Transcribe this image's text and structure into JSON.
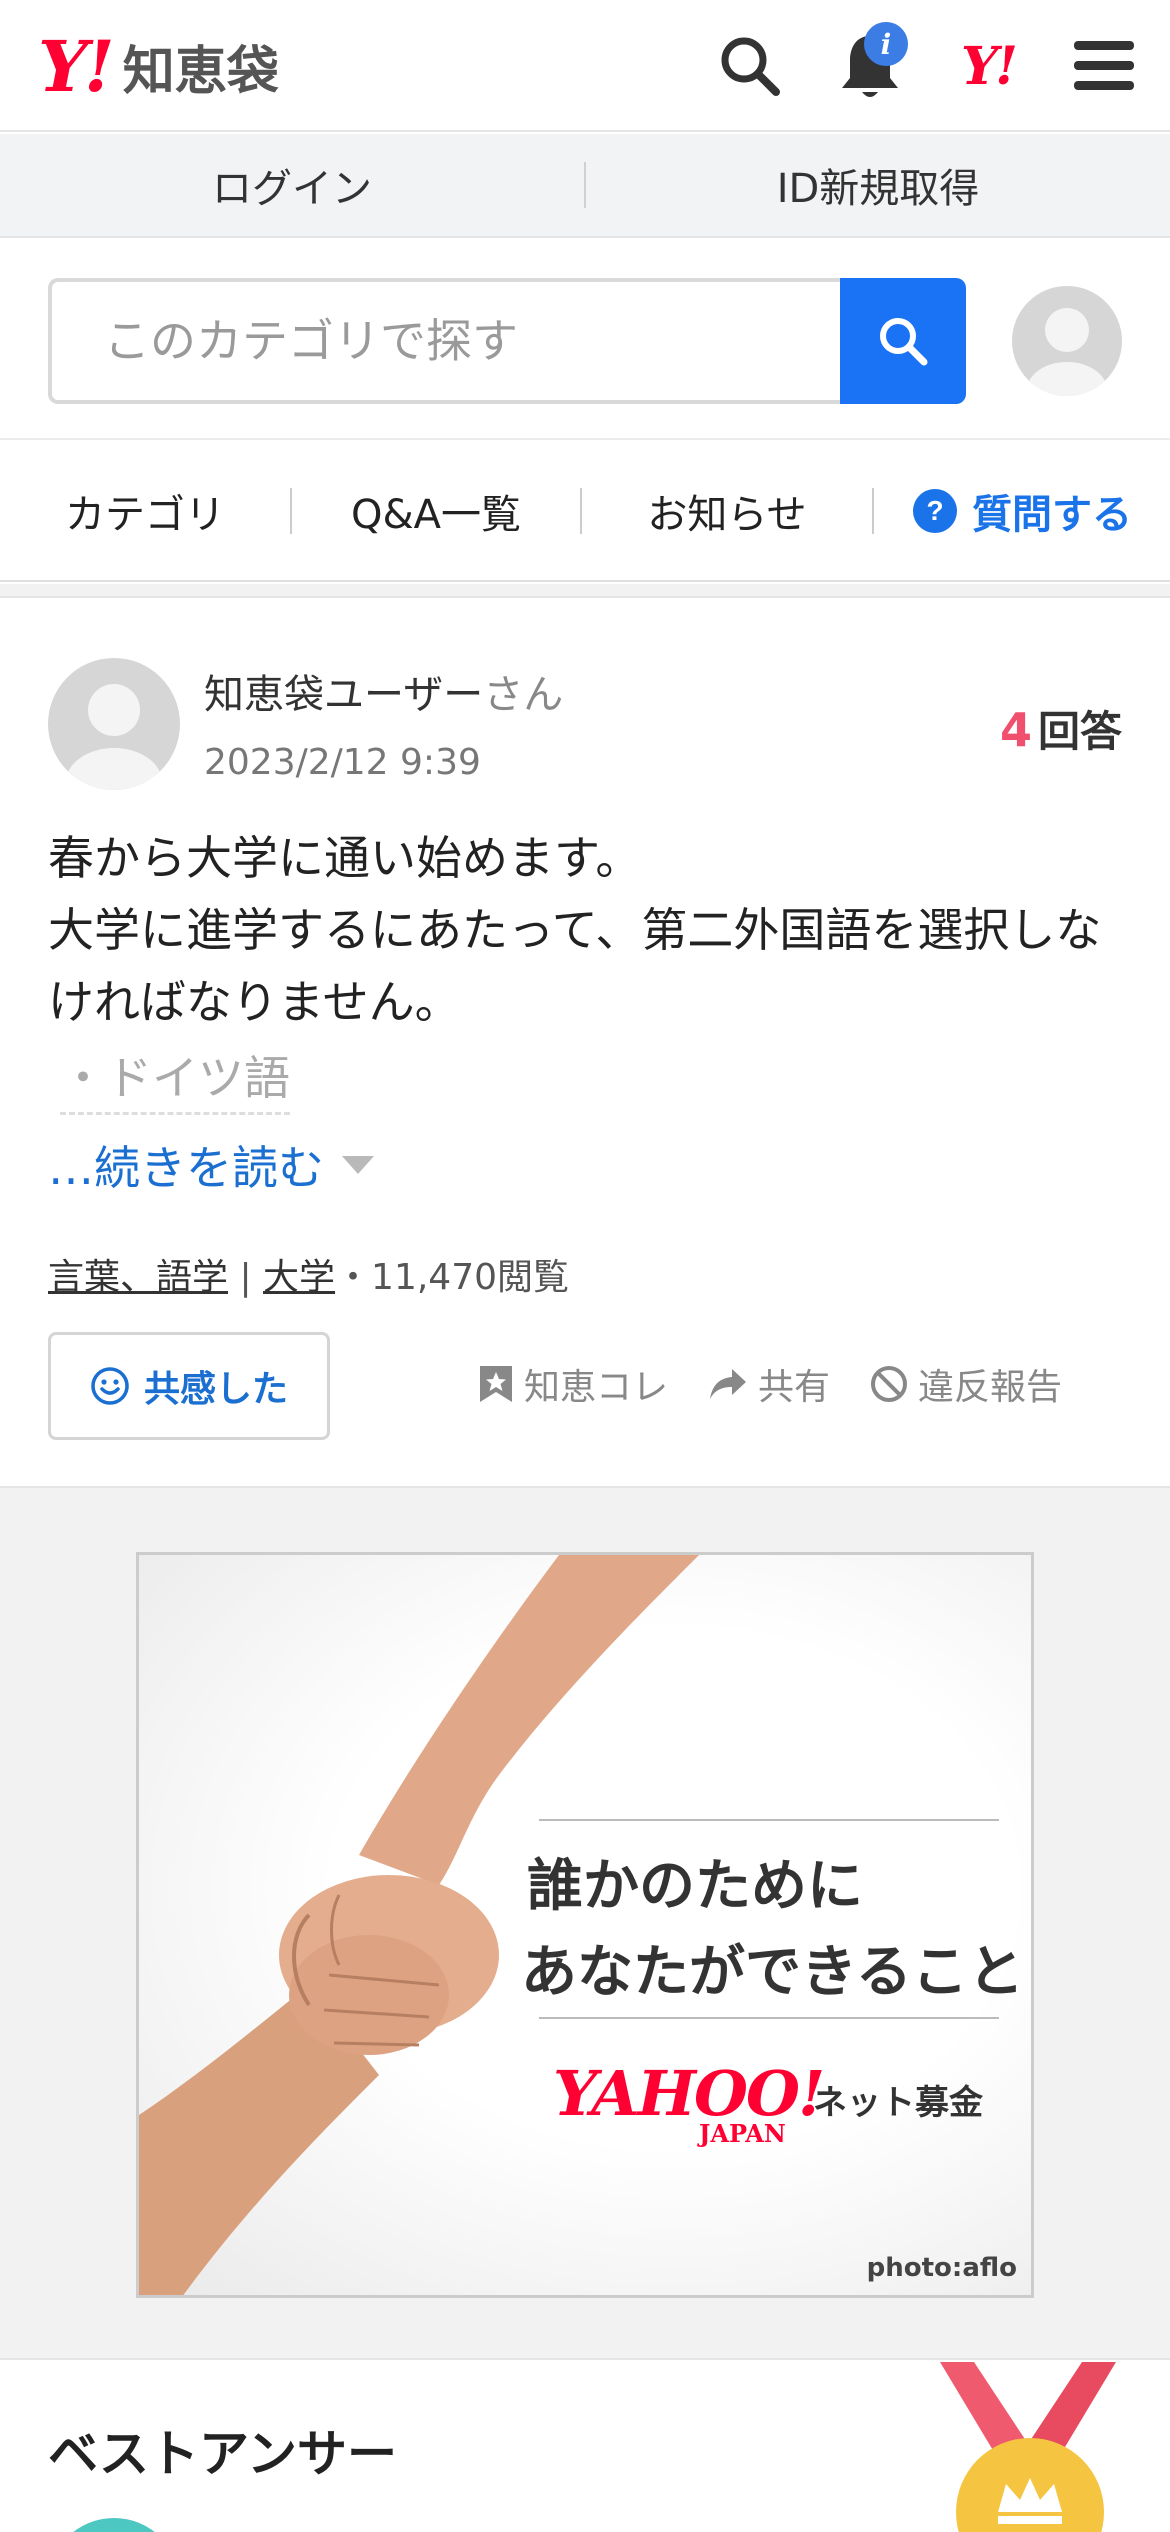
{
  "header": {
    "logo_mark": "Y!",
    "logo_name": "知恵袋",
    "notification_badge": "i",
    "yj_mark": "Y!"
  },
  "login_bar": {
    "login_label": "ログイン",
    "register_label": "ID新規取得"
  },
  "search": {
    "placeholder": "このカテゴリで探す"
  },
  "nav": {
    "category": "カテゴリ",
    "qa_list": "Q&A一覧",
    "notice": "お知らせ",
    "ask": "質問する"
  },
  "question": {
    "user": "知恵袋ユーザー",
    "user_suffix": "さん",
    "date": "2023/2/12 9:39",
    "answer_count": "4",
    "answer_label": "回答",
    "body_line1": "春から大学に通い始めます。",
    "body_line2": "大学に進学するにあたって、第二外国語を選択しなければなりません。",
    "faded_line": "・ドイツ語",
    "read_more": "…続きを読む",
    "tag1": "言葉、語学",
    "tag_sep": " | ",
    "tag2": "大学",
    "views": "・11,470閲覧",
    "empathy_label": "共感した",
    "collect_label": "知恵コレ",
    "share_label": "共有",
    "report_label": "違反報告"
  },
  "ad": {
    "line1": "誰かのために",
    "line2": "あなたができること",
    "brand": "YAHOO!",
    "brand_sub": "JAPAN",
    "service": "ネット募金",
    "credit": "photo:aflo"
  },
  "best_answer": {
    "title": "ベストアンサー"
  },
  "colors": {
    "brand_red": "#ff0033",
    "accent_blue": "#1a73f5",
    "answer_count_pink": "#f0506e",
    "link_blue": "#1a6fd0"
  }
}
